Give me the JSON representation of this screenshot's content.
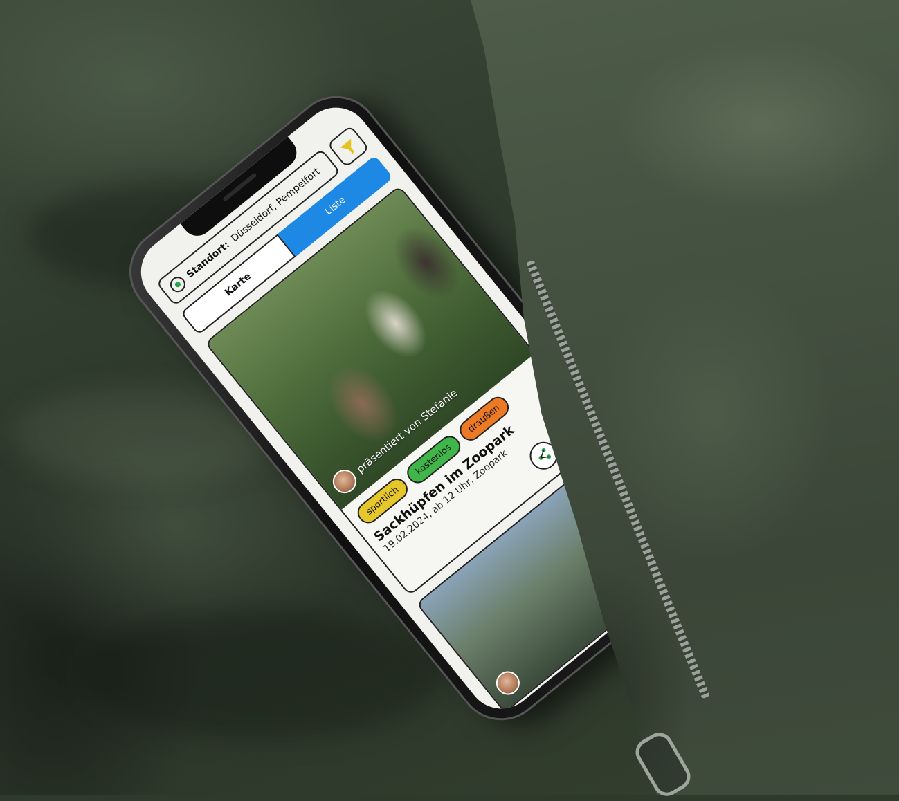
{
  "app": {
    "location_label": "Standort:",
    "location_value": "Düsseldorf, Pempelfort",
    "filter_icon": "funnel-icon",
    "tabs": {
      "map": "Karte",
      "list": "Liste",
      "active": "list"
    },
    "accent_color": "#1e88e5"
  },
  "event_card": {
    "presenter": "präsentiert von Stefanie",
    "tags": [
      {
        "label": "sportlich",
        "color": "#e5c72b"
      },
      {
        "label": "kostenlos",
        "color": "#3fb54a"
      },
      {
        "label": "draußen",
        "color": "#ec7a24"
      }
    ],
    "title": "Sackhüpfen im Zoopark",
    "subtitle": "19.02.2024, ab 12 Uhr, Zoopark",
    "share_icon": "share-icon"
  }
}
